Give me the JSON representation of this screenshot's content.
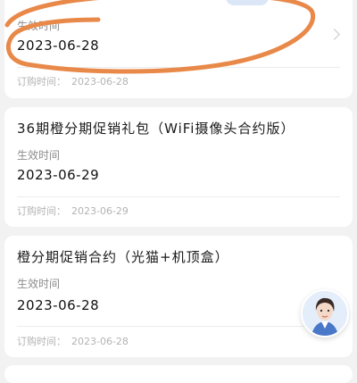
{
  "orders": [
    {
      "title": "",
      "effective_label": "生效时间",
      "effective_date": "2023-06-28",
      "order_label": "订购时间：",
      "order_date": "2023-06-28"
    },
    {
      "title": "36期橙分期促销礼包（WiFi摄像头合约版）",
      "effective_label": "生效时间",
      "effective_date": "2023-06-29",
      "order_label": "订购时间：",
      "order_date": "2023-06-29"
    },
    {
      "title": "橙分期促销合约（光猫+机顶盒）",
      "effective_label": "生效时间",
      "effective_date": "2023-06-28",
      "order_label": "订购时间：",
      "order_date": "2023-06-28"
    }
  ],
  "colors": {
    "annotation_stroke": "#e8894a",
    "badge": "#dbe7f7"
  },
  "icons": {
    "chevron": "chevron-right-icon",
    "assistant": "customer-service-avatar-icon"
  }
}
